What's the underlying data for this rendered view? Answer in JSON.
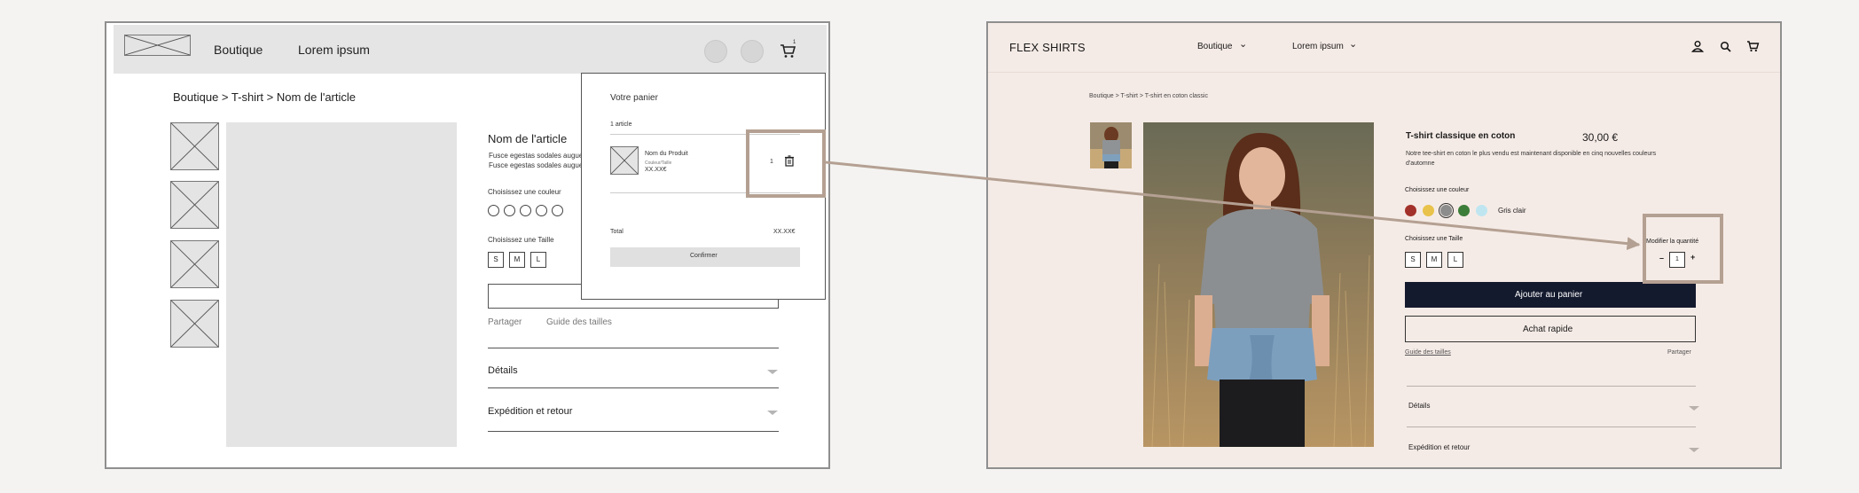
{
  "wireframe": {
    "nav": {
      "link1": "Boutique",
      "link2": "Lorem ipsum",
      "cart_count": "1"
    },
    "breadcrumb": "Boutique > T-shirt > Nom de l'article",
    "product": {
      "title": "Nom de l'article",
      "desc_line1": "Fusce egestas sodales augue",
      "desc_line2": "Fusce egestas sodales augue",
      "color_label": "Choisissez une couleur",
      "size_label": "Choisissez une Taille",
      "sizes": [
        "S",
        "M",
        "L"
      ],
      "share": "Partager",
      "size_guide": "Guide des tailles",
      "accordion1": "Détails",
      "accordion2": "Expédition et retour"
    },
    "cart": {
      "title": "Votre panier",
      "count": "1 article",
      "item_name": "Nom du Produit",
      "item_variant": "Couleur/Taille",
      "item_price": "XX.XX€",
      "qty": "1",
      "total_label": "Total",
      "total_value": "XX.XX€",
      "confirm": "Confirmer"
    }
  },
  "mockup": {
    "brand": "FLEX SHIRTS",
    "nav": {
      "link1": "Boutique",
      "link2": "Lorem ipsum"
    },
    "breadcrumb": "Boutique > T-shirt > T-shirt en coton classic",
    "product": {
      "title": "T-shirt classique en coton",
      "price": "30,00 €",
      "desc_line1": "Notre tee-shirt en coton le plus vendu est maintenant disponible en cinq nouvelles couleurs",
      "desc_line2": "d'automne",
      "color_label": "Choisissez une couleur",
      "selected_color": "Gris clair",
      "swatches": [
        "#a3312b",
        "#e8c24a",
        "#8c8c8c",
        "#3d7d3a",
        "#bfe6f0"
      ],
      "size_label": "Choisissez une Taille",
      "sizes": [
        "S",
        "M",
        "L"
      ],
      "qty_label": "Modifier la quantité",
      "qty_minus": "–",
      "qty_value": "1",
      "qty_plus": "+",
      "add_to_cart": "Ajouter au panier",
      "quick_buy": "Achat rapide",
      "size_guide": "Guide des tailles",
      "share": "Partager",
      "accordion1": "Détails",
      "accordion2": "Expédition et retour"
    }
  },
  "colors": {
    "accent": "#b4a092",
    "mockup_bg": "#f5ebe6",
    "primary_button": "#141a2e",
    "placeholder_gray": "#e4e4e4"
  }
}
